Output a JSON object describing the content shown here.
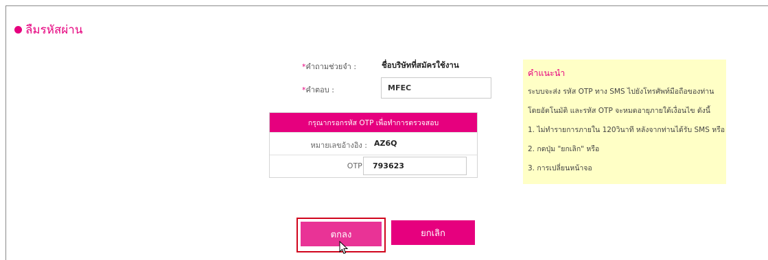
{
  "header": {
    "title": "ลืมรหัสผ่าน"
  },
  "form": {
    "question_label": "คำถามช่วยจำ :",
    "question_value": "ชื่อบริษัทที่สมัครใช้งาน",
    "answer_label": "คำตอบ :",
    "answer_value": "MFEC",
    "required_mark": "*"
  },
  "otp": {
    "heading": "กรุณากรอกรหัส OTP เพื่อทำการตรวจสอบ",
    "ref_label": "หมายเลขอ้างอิง :",
    "ref_value": "AZ6Q",
    "otp_label": "OTP :",
    "otp_value": "793623"
  },
  "advice": {
    "title": "คำแนะนำ",
    "lines": [
      "ระบบจะส่ง รหัส OTP ทาง SMS ไปยังโทรศัพท์มือถือของท่าน",
      "โดยอัตโนมัติ และรหัส OTP จะหมดอายุภายใต้เงื่อนไข ดังนี้",
      "1. ไม่ทำรายการภายใน 120วินาที หลังจากท่านได้รับ SMS หรือ",
      "2. กดปุ่ม \"ยกเลิก\" หรือ",
      "3. การเปลี่ยนหน้าจอ"
    ]
  },
  "buttons": {
    "ok": "ตกลง",
    "cancel": "ยกเลิก"
  },
  "colors": {
    "accent": "#e6007e",
    "advice_bg": "#ffffc6",
    "focus_outline": "#d0021b"
  }
}
